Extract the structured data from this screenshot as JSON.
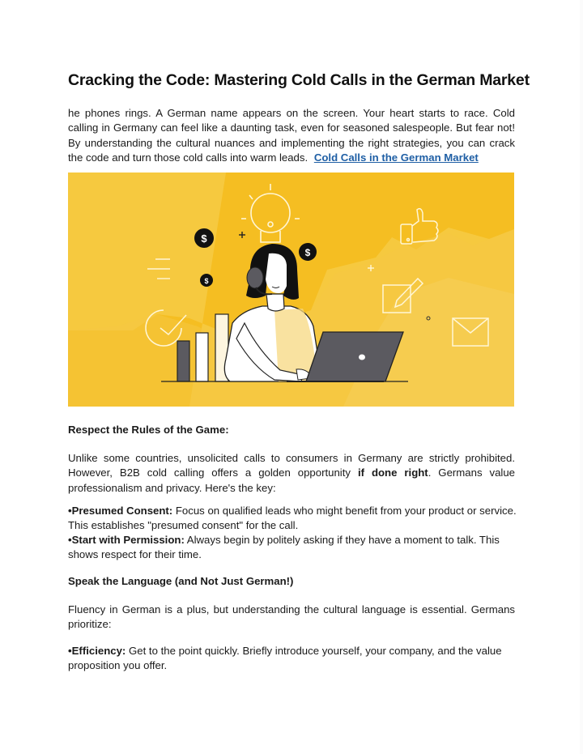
{
  "document": {
    "title": "Cracking the Code: Mastering Cold Calls in the German Market",
    "intro": {
      "text": "he phones rings. A German name appears on the screen. Your heart starts to race. Cold calling in Germany can feel like a daunting task, even for seasoned salespeople. But fear not! By understanding the cultural nuances and implementing the right strategies, you can  crack the code and turn those cold calls into warm leads.",
      "link_text": "Cold Calls in the German Market"
    },
    "hero_image": {
      "description": "Illustration of a woman with a headset typing on a laptop, yellow background with dollar coins, light bulb, thumbs-up, pencil, envelope and bar chart icons",
      "colors": {
        "background": "#f6c93f",
        "background_dark": "#f5bd1f",
        "accent_dark": "#5b5a60",
        "ink": "#111111"
      },
      "coin_symbol": "$"
    },
    "sections": [
      {
        "heading": "Respect the Rules of the Game:",
        "paragraph": {
          "before_bold": "Unlike some countries, unsolicited calls to consumers in Germany are strictly prohibited. However, B2B cold calling offers a golden opportunity",
          "bold": "if done right",
          "after_bold": ". Germans value professionalism and privacy. Here's the key:"
        },
        "bullets": [
          {
            "marker": "•",
            "label": "Presumed Consent:",
            "text": " Focus on qualified leads who might benefit from your product or service. This establishes \"presumed consent\" for the call."
          },
          {
            "marker": "•",
            "label": "Start with Permission:",
            "text": " Always begin by politely asking if they have a moment to talk. This shows respect for their time."
          }
        ]
      },
      {
        "heading": "Speak the Language (and Not Just German!)",
        "paragraph": {
          "text": "Fluency in German is a plus, but understanding the cultural language is essential. Germans prioritize:"
        },
        "bullets": [
          {
            "marker": "•",
            "label": "Efficiency:",
            "text": " Get to the point quickly. Briefly introduce yourself, your company, and the value proposition you offer."
          }
        ]
      }
    ]
  }
}
